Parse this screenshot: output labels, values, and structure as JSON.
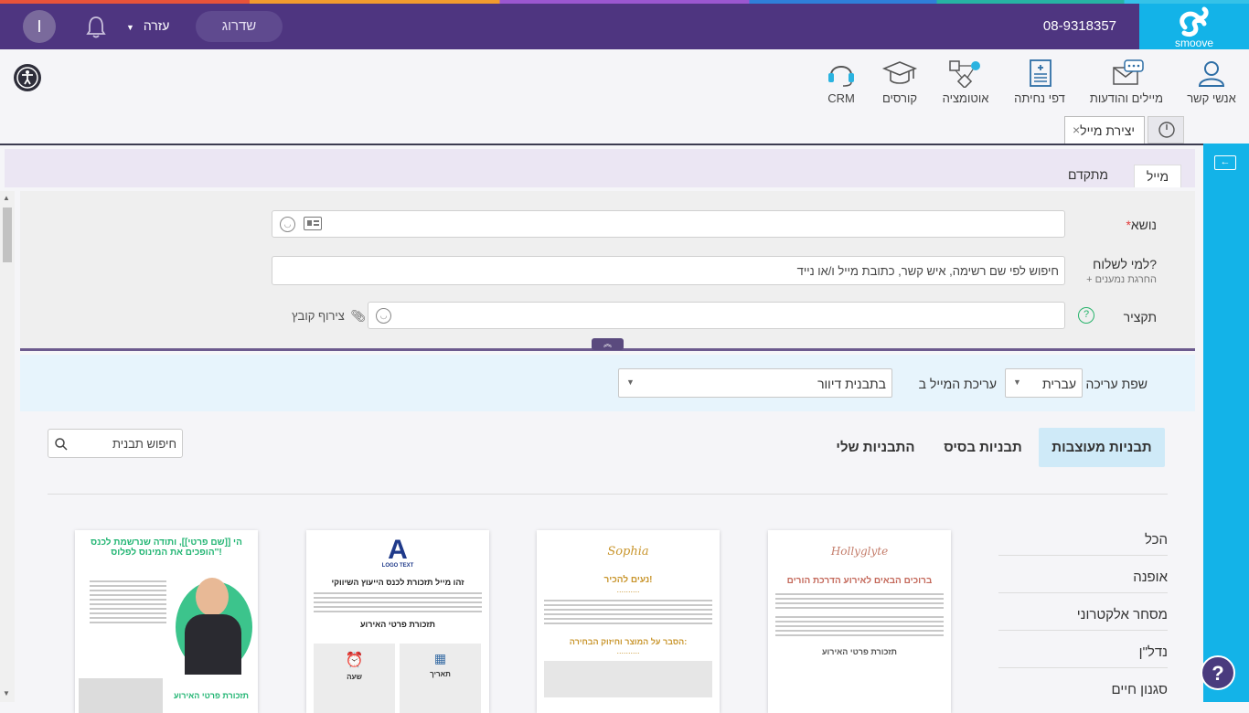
{
  "header": {
    "brand": "smoove",
    "phone": "08-9318357",
    "upgrade_label": "שדרוג",
    "help_label": "עזרה",
    "avatar_initial": "I"
  },
  "nav": {
    "items": [
      {
        "label": "אנשי קשר",
        "icon": "contacts-icon"
      },
      {
        "label": "מיילים והודעות",
        "icon": "emails-messages-icon"
      },
      {
        "label": "דפי נחיתה",
        "icon": "landing-pages-icon"
      },
      {
        "label": "אוטומציה",
        "icon": "automation-icon"
      },
      {
        "label": "קורסים",
        "icon": "courses-icon"
      },
      {
        "label": "CRM",
        "icon": "crm-headset-icon"
      }
    ]
  },
  "tabs": {
    "active_label": "יצירת מייל",
    "close_symbol": "×"
  },
  "subtabs": {
    "mail": "מייל",
    "advanced": "מתקדם"
  },
  "form": {
    "subject_label": "נושא",
    "required_mark": "*",
    "to_label": "למי לשלוח?",
    "exclude_label": "+ החרגת נמענים",
    "to_placeholder": "חיפוש לפי שם רשימה, איש קשר, כתובת מייל ו/או נייד",
    "summary_label": "תקציר",
    "attach_label": "צירוף קובץ"
  },
  "lang": {
    "edit_lang_label": "שפת עריכה",
    "edit_lang_value": "עברית",
    "edit_mode_label": "עריכת המייל ב",
    "edit_mode_value": "בתבנית דיוור"
  },
  "templates": {
    "tabs": [
      "תבניות מעוצבות",
      "תבניות בסיס",
      "התבניות שלי"
    ],
    "search_placeholder": "חיפוש תבנית",
    "categories": [
      "הכל",
      "אופנה",
      "מסחר אלקטרוני",
      "נדל\"ן",
      "סגנון חיים"
    ],
    "cards": [
      {
        "logo": "Hollyglyte",
        "title": "ברוכים הבאים לאירוע הדרכת הורים",
        "footer": "תזכורת פרטי האירוע"
      },
      {
        "logo": "Sophia",
        "title": "נעים להכיר!",
        "dots": "..........",
        "subtitle": "הסבר על המוצר וחיזוק הבחירה:"
      },
      {
        "logo": "LOGO TEXT",
        "title": "זהו מייל תזכורת לכנס הייעוץ השיווקי",
        "subtitle": "תזכורת פרטי האירוע",
        "box1_title": "תאריך",
        "box2_title": "שעה"
      },
      {
        "title": "הי [[שם פרטי]], ותודה שנרשמת לכנס 'הופכים את המינוס לפלוס'!",
        "footer": "תזכורת פרטי האירוע"
      }
    ]
  },
  "help_bubble": "?"
}
